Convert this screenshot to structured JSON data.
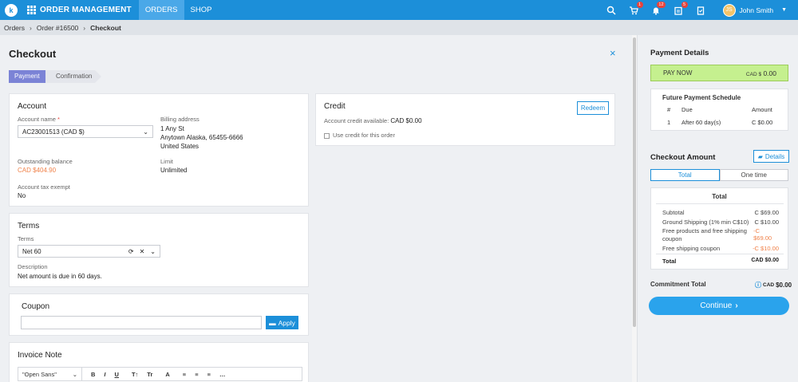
{
  "nav": {
    "logo": "k",
    "app_title": "ORDER MANAGEMENT",
    "tabs": [
      {
        "label": "ORDERS"
      },
      {
        "label": "SHOP"
      }
    ],
    "cart_badge": "1",
    "bell_badge": "12",
    "orders_badge": "5",
    "user_name": "John Smith",
    "avatar_initial": "JS"
  },
  "breadcrumb": {
    "items": [
      "Orders",
      "Order #16500"
    ],
    "current": "Checkout"
  },
  "page": {
    "title": "Checkout",
    "close": "×"
  },
  "steps": [
    {
      "label": "Payment"
    },
    {
      "label": "Confirmation"
    }
  ],
  "account": {
    "title": "Account",
    "name_label": "Account name",
    "name_value": "AC23001513 (CAD $)",
    "billing_label": "Billing address",
    "billing_lines": [
      "1 Any St",
      "Anytown Alaska, 65455-6666",
      "United States"
    ],
    "outstanding_label": "Outstanding balance",
    "outstanding_value": "CAD $404.90",
    "limit_label": "Limit",
    "limit_value": "Unlimited",
    "tax_label": "Account tax exempt",
    "tax_value": "No"
  },
  "credit": {
    "title": "Credit",
    "redeem": "Redeem",
    "available_label": "Account credit available:",
    "available_value": "CAD $0.00",
    "use_credit": "Use credit for this order"
  },
  "terms": {
    "title": "Terms",
    "label": "Terms",
    "value": "Net 60",
    "desc_label": "Description",
    "desc_value": "Net amount is due in 60 days."
  },
  "coupon": {
    "title": "Coupon",
    "input_value": "",
    "apply": "Apply"
  },
  "invoice": {
    "title": "Invoice Note",
    "font": "\"Open Sans\"",
    "tools": [
      "B",
      "I",
      "U",
      "T↑",
      "Tr",
      "A",
      "≡",
      "≡",
      "≡",
      "…"
    ]
  },
  "payment": {
    "title": "Payment Details",
    "pay_now": "PAY NOW",
    "pay_now_currency": "CAD $",
    "pay_now_amount": "0.00",
    "schedule_title": "Future Payment Schedule",
    "schedule_headers": [
      "#",
      "Due",
      "Amount"
    ],
    "schedule_rows": [
      {
        "num": "1",
        "due": "After 60 day(s)",
        "amount": "C $0.00"
      }
    ]
  },
  "checkout": {
    "title": "Checkout Amount",
    "details": "Details",
    "seg_total": "Total",
    "seg_one_time": "One time",
    "box_title": "Total",
    "rows": [
      {
        "label": "Subtotal",
        "value": "C $69.00"
      },
      {
        "label": "Ground Shipping (1% min C$10)",
        "value": "C $10.00"
      },
      {
        "label": "Free products and free shipping coupon",
        "value": "-C $69.00"
      },
      {
        "label": "Free shipping coupon",
        "value": "-C $10.00"
      }
    ],
    "total_label": "Total",
    "total_value": "CAD $0.00",
    "commitment_label": "Commitment Total",
    "commitment_value": "$0.00",
    "commitment_cur": "CAD",
    "continue": "Continue"
  },
  "colors": {
    "primary": "#1c8fd9",
    "step_active": "#7b83d6",
    "pay_now_bg": "#c5f08f",
    "negative": "#f0824a"
  }
}
